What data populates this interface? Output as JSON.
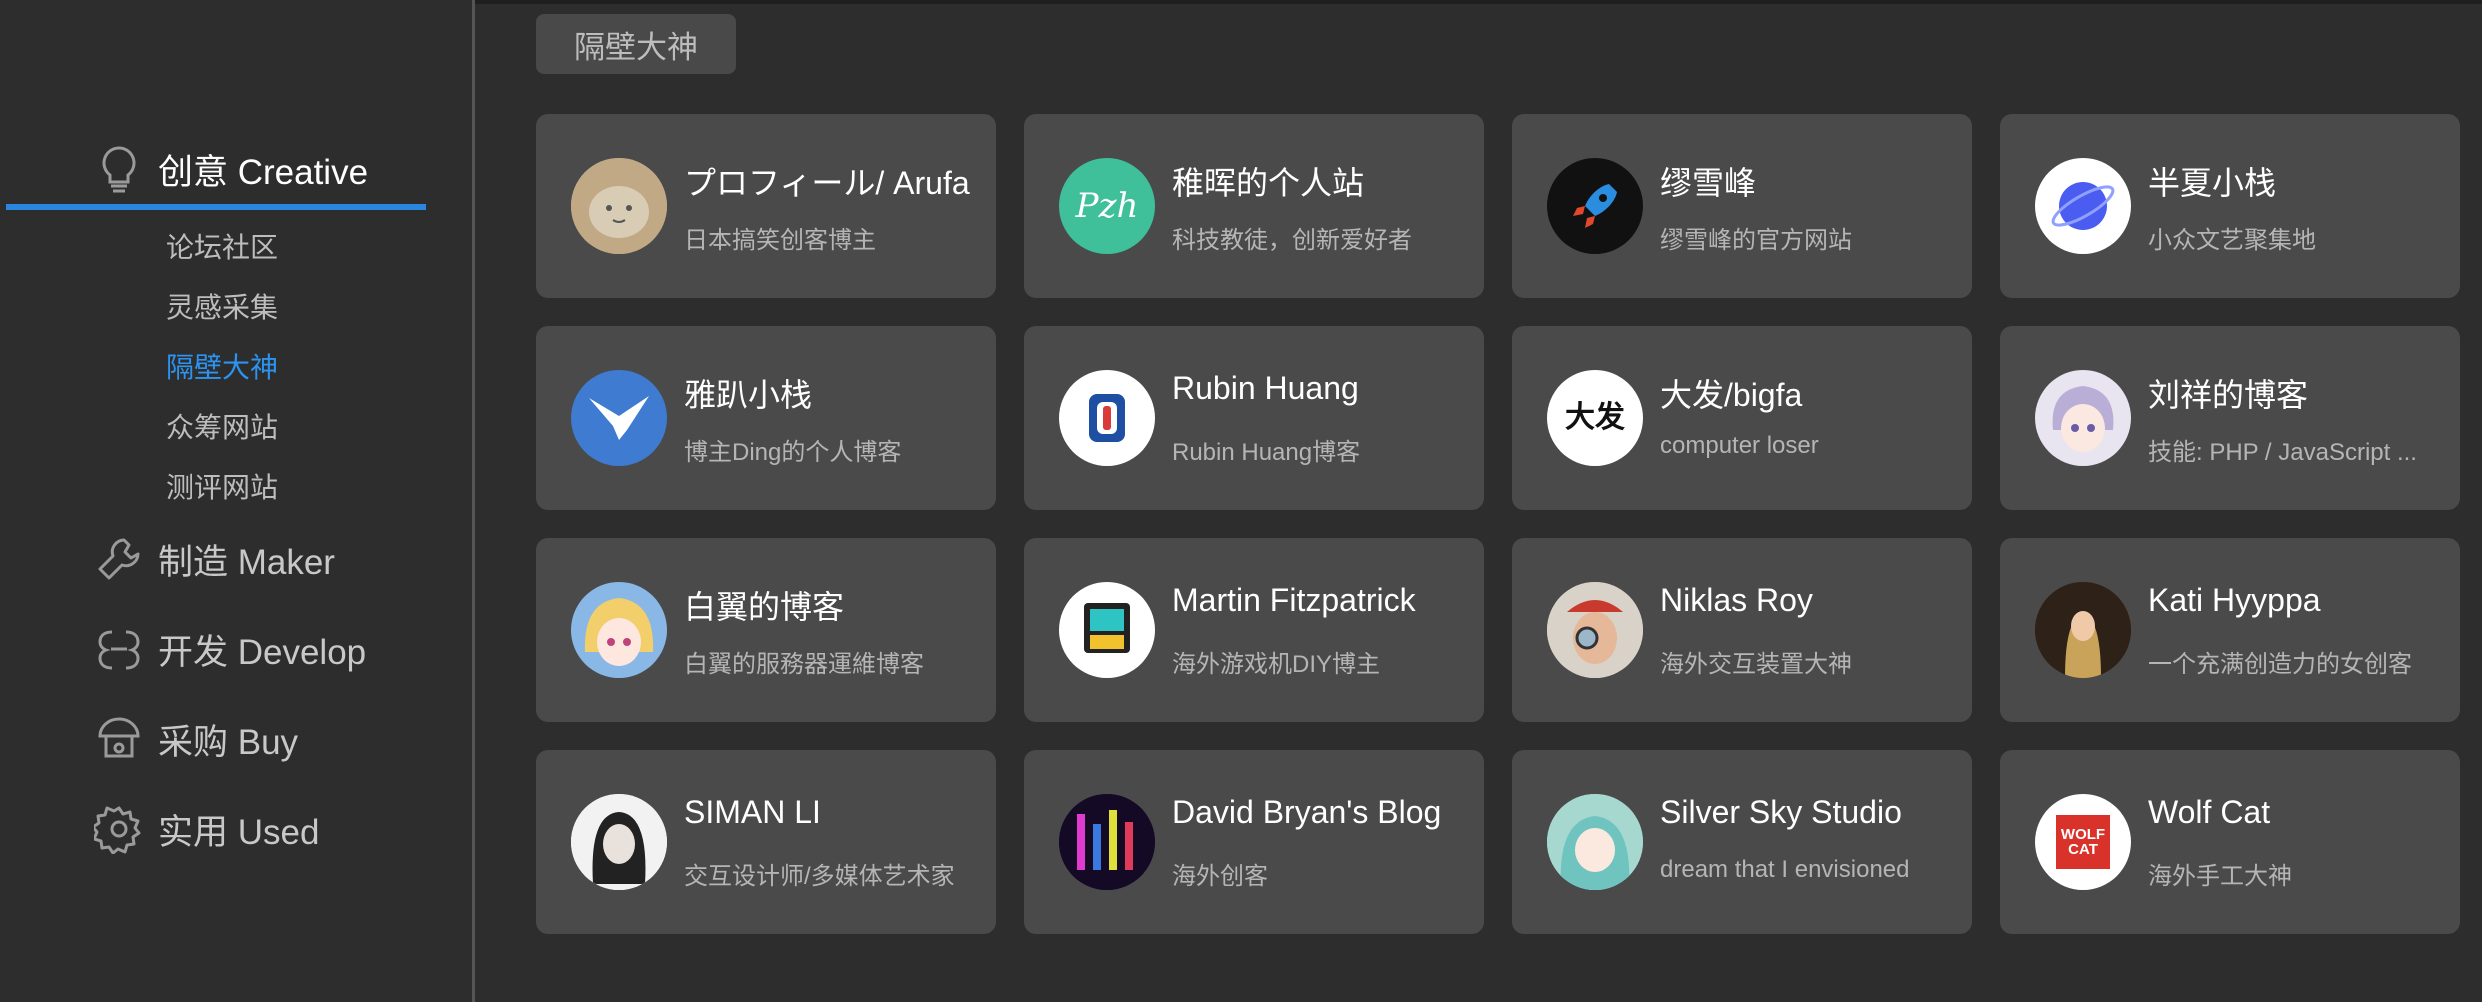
{
  "sidebar": {
    "groups": [
      {
        "label": "创意 Creative",
        "icon": "lightbulb-icon"
      },
      {
        "label": "制造 Maker",
        "icon": "wrench-icon"
      },
      {
        "label": "开发 Develop",
        "icon": "code-icon"
      },
      {
        "label": "采购 Buy",
        "icon": "shop-icon"
      },
      {
        "label": "实用 Used",
        "icon": "gear-icon"
      }
    ],
    "sub_items": [
      "论坛社区",
      "灵感采集",
      "隔壁大神",
      "众筹网站",
      "测评网站"
    ]
  },
  "section": {
    "label": "隔壁大神"
  },
  "cards": [
    {
      "title": "プロフィール/ Arufa",
      "desc": "日本搞笑创客博主"
    },
    {
      "title": "稚晖的个人站",
      "desc": "科技教徒，创新爱好者",
      "avatar_text": "Pzh"
    },
    {
      "title": "缪雪峰",
      "desc": "缪雪峰的官方网站"
    },
    {
      "title": "半夏小栈",
      "desc": "小众文艺聚集地"
    },
    {
      "title": "雅趴小栈",
      "desc": "博主Ding的个人博客"
    },
    {
      "title": "Rubin Huang",
      "desc": "Rubin Huang博客"
    },
    {
      "title": "大发/bigfa",
      "desc": "computer loser",
      "avatar_text": "大发"
    },
    {
      "title": "刘祥的博客",
      "desc": "技能: PHP / JavaScript ..."
    },
    {
      "title": "白翼的博客",
      "desc": "白翼的服務器運維博客"
    },
    {
      "title": "Martin Fitzpatrick",
      "desc": "海外游戏机DIY博主"
    },
    {
      "title": "Niklas Roy",
      "desc": "海外交互装置大神"
    },
    {
      "title": "Kati Hyyppa",
      "desc": "一个充满创造力的女创客"
    },
    {
      "title": "SIMAN LI",
      "desc": "交互设计师/多媒体艺术家"
    },
    {
      "title": "David Bryan's Blog",
      "desc": "海外创客"
    },
    {
      "title": "Silver Sky Studio",
      "desc": "dream that I envisioned"
    },
    {
      "title": "Wolf Cat",
      "desc": "海外手工大神",
      "avatar_text": "WOLF CAT"
    }
  ],
  "colors": {
    "accent": "#2b86e0",
    "active_sub": "#2b93f0",
    "card_bg": "#4a4a4a",
    "page_bg": "#2d2d2d"
  }
}
